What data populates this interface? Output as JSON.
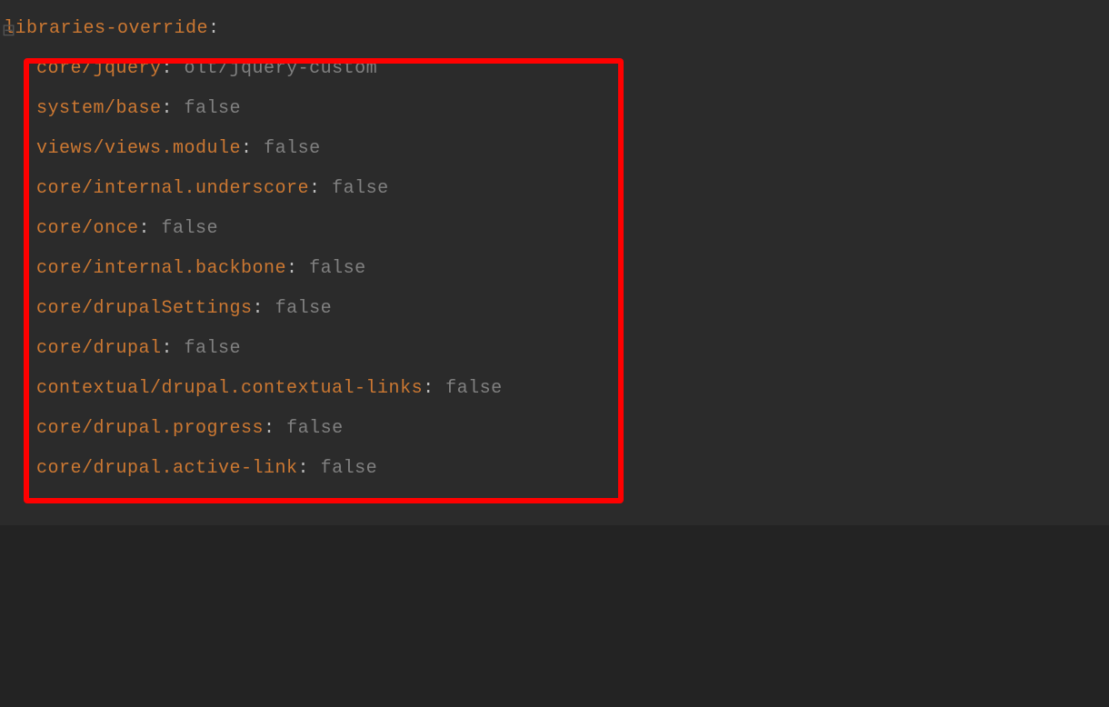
{
  "header": {
    "key": "libraries-override",
    "colon": ":"
  },
  "lines": [
    {
      "key": "core/jquery",
      "val": "olt/jquery-custom",
      "obscured": true
    },
    {
      "key": "system/base",
      "val": "false"
    },
    {
      "key": "views/views.module",
      "val": "false"
    },
    {
      "key": "core/internal.underscore",
      "val": "false"
    },
    {
      "key": "core/once",
      "val": "false"
    },
    {
      "key": "core/internal.backbone",
      "val": "false"
    },
    {
      "key": "core/drupalSettings",
      "val": "false"
    },
    {
      "key": "core/drupal",
      "val": "false"
    },
    {
      "key": "contextual/drupal.contextual-links",
      "val": "false"
    },
    {
      "key": "core/drupal.progress",
      "val": "false"
    },
    {
      "key": "core/drupal.active-link",
      "val": "false"
    }
  ]
}
